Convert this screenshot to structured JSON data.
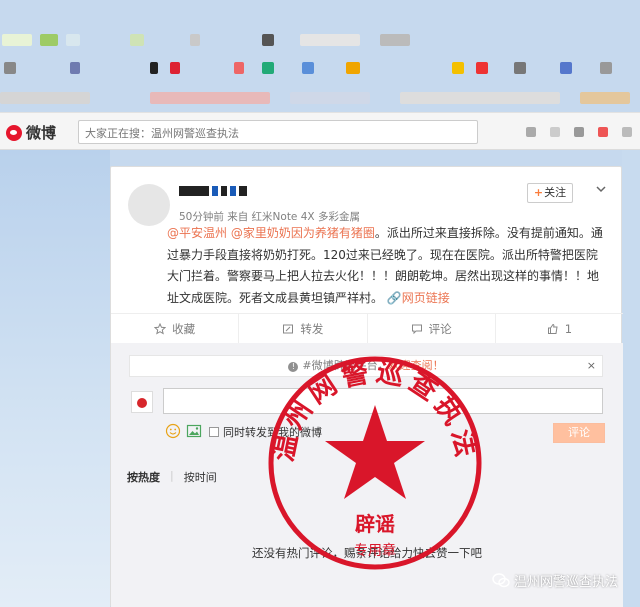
{
  "header": {
    "logo_text": "微博",
    "search_placeholder": "大家正在搜：温州网警巡查执法"
  },
  "post": {
    "meta": "50分钟前 来自 红米Note 4X 多彩金属",
    "follow_label": "关注",
    "mention_1": "@平安温州",
    "mention_2": "@家里奶奶因为养猪有猪圈",
    "body": "。派出所过来直接拆除。没有提前通知。通过暴力手段直接将奶奶打死。120过来已经晚了。现在在医院。派出所特警把医院大门拦着。警察要马上把人拉去火化！！！朗朗乾坤。居然出现这样的事情！！地址文成医院。死者文成县黄坦镇严祥村。",
    "link_label": "网页链接"
  },
  "actions": {
    "favorite_label": "收藏",
    "repost_label": "转发",
    "comment_label": "评论",
    "like_count": "1"
  },
  "comment": {
    "notice_prefix": "#微博辟谣平台，",
    "notice_link": "欢迎查阅！",
    "notice_close": "×",
    "repost_check_label": "同时转发到我的微博",
    "submit_label": "评论",
    "sort_hot": "按热度",
    "sort_time": "按时间",
    "empty_hot": "还没有热门评论，赐条评论给力快去赞一下吧"
  },
  "stamp": {
    "arc_text": "温州网警巡查执法",
    "center_text": "辟谣",
    "bottom_text": "专用章",
    "color": "#d9162a"
  },
  "watermark": {
    "text": "温州网警巡查执法"
  },
  "colors": {
    "accent": "#eb7350",
    "weibo_red": "#e6162d"
  }
}
